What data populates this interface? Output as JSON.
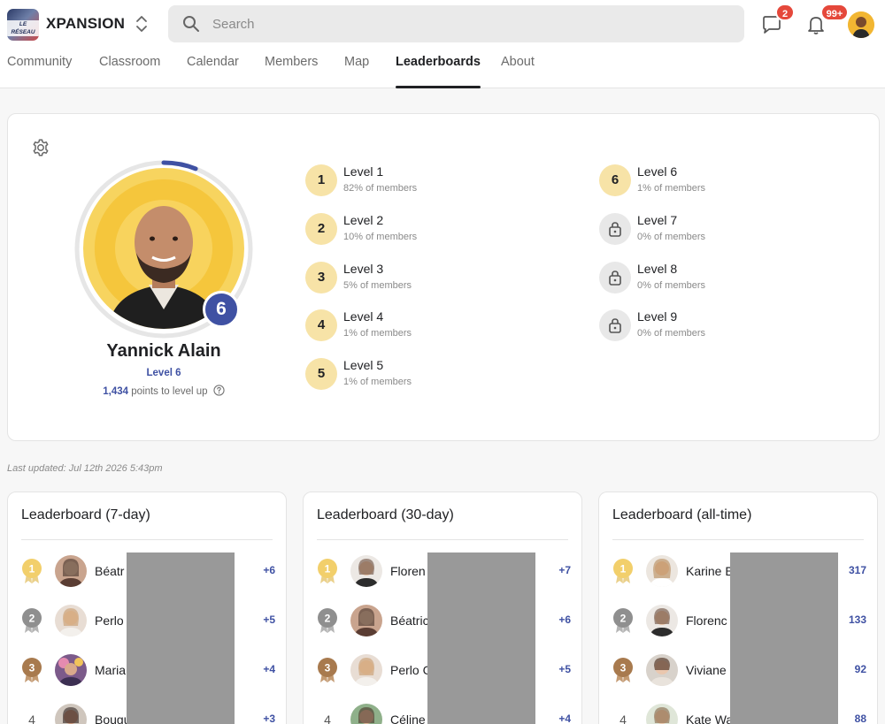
{
  "header": {
    "logo_text": "LE RÉSEAU",
    "brand": "XPANSION",
    "search_placeholder": "Search",
    "chat_badge": "2",
    "notif_badge": "99+"
  },
  "tabs": [
    {
      "label": "Community",
      "active": false
    },
    {
      "label": "Classroom",
      "active": false
    },
    {
      "label": "Calendar",
      "active": false
    },
    {
      "label": "Members",
      "active": false
    },
    {
      "label": "Map",
      "active": false
    },
    {
      "label": "Leaderboards",
      "active": true
    },
    {
      "label": "About",
      "active": false
    }
  ],
  "profile": {
    "name": "Yannick Alain",
    "level_label": "Level 6",
    "level_number": "6",
    "points": "1,434",
    "points_suffix": "points to level up",
    "level_progress": 0.06
  },
  "levels": [
    {
      "number": "1",
      "name": "Level 1",
      "pct": "82% of members",
      "locked": false
    },
    {
      "number": "2",
      "name": "Level 2",
      "pct": "10% of members",
      "locked": false
    },
    {
      "number": "3",
      "name": "Level 3",
      "pct": "5% of members",
      "locked": false
    },
    {
      "number": "4",
      "name": "Level 4",
      "pct": "1% of members",
      "locked": false
    },
    {
      "number": "5",
      "name": "Level 5",
      "pct": "1% of members",
      "locked": false
    },
    {
      "number": "6",
      "name": "Level 6",
      "pct": "1% of members",
      "locked": false
    },
    {
      "number": "7",
      "name": "Level 7",
      "pct": "0% of members",
      "locked": true
    },
    {
      "number": "8",
      "name": "Level 8",
      "pct": "0% of members",
      "locked": true
    },
    {
      "number": "9",
      "name": "Level 9",
      "pct": "0% of members",
      "locked": true
    }
  ],
  "last_updated": "Last updated: Jul 12th 2026 5:43pm",
  "leaderboards": [
    {
      "title": "Leaderboard (7-day)",
      "rows": [
        {
          "rank": "1",
          "name": "Béatr",
          "points": "+6"
        },
        {
          "rank": "2",
          "name": "Perlo",
          "points": "+5"
        },
        {
          "rank": "3",
          "name": "Maria",
          "points": "+4"
        },
        {
          "rank": "4",
          "name": "Bougu",
          "points": "+3"
        }
      ]
    },
    {
      "title": "Leaderboard (30-day)",
      "rows": [
        {
          "rank": "1",
          "name": "Floren",
          "points": "+7"
        },
        {
          "rank": "2",
          "name": "Béatric",
          "points": "+6"
        },
        {
          "rank": "3",
          "name": "Perlo C",
          "points": "+5"
        },
        {
          "rank": "4",
          "name": "Céline",
          "points": "+4"
        }
      ]
    },
    {
      "title": "Leaderboard (all-time)",
      "rows": [
        {
          "rank": "1",
          "name": "Karine E",
          "points": "317"
        },
        {
          "rank": "2",
          "name": "Florenc",
          "points": "133"
        },
        {
          "rank": "3",
          "name": "Viviane",
          "points": "92"
        },
        {
          "rank": "4",
          "name": "Kate Wa",
          "points": "88"
        }
      ]
    }
  ],
  "colors": {
    "accent": "#3f51a3",
    "level_fill": "#f7e3a7",
    "gold": "#f2cf6b",
    "silver": "#8f8f8f",
    "bronze": "#a87a4e"
  }
}
